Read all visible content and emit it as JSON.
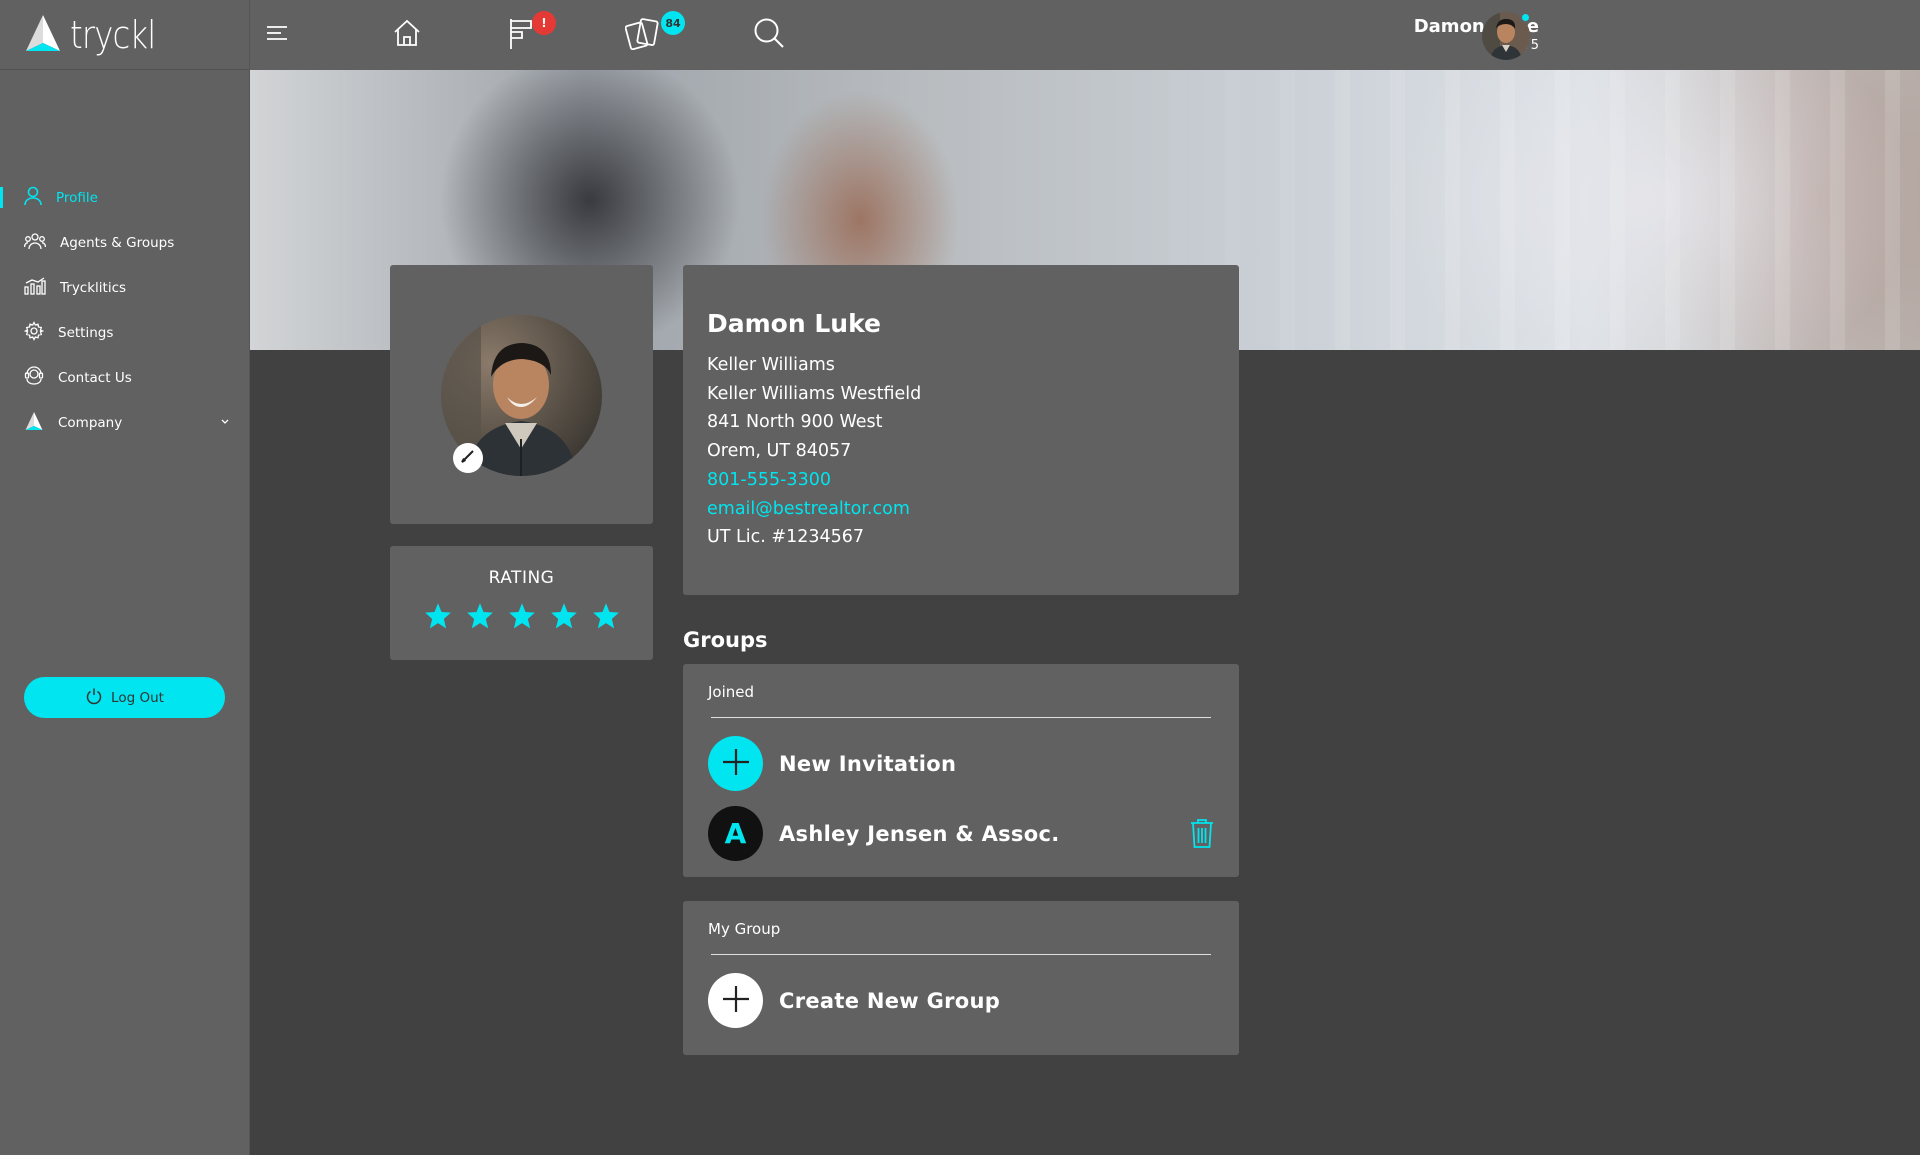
{
  "app": {
    "logo_text": "tryckl"
  },
  "sidebar": {
    "items": [
      {
        "label": "Profile",
        "icon": "user-icon",
        "active": true
      },
      {
        "label": "Agents & Groups",
        "icon": "group-icon"
      },
      {
        "label": "Trycklitics",
        "icon": "analytics-icon"
      },
      {
        "label": "Settings",
        "icon": "gear-icon"
      },
      {
        "label": "Contact Us",
        "icon": "contact-icon"
      },
      {
        "label": "Company",
        "icon": "company-logo-icon",
        "expandable": true
      }
    ],
    "logout_label": "Log Out"
  },
  "topbar": {
    "notifications_badge": "!",
    "cards_badge": "84",
    "user_name": "Damon Luke",
    "user_balance": "$ 19.75"
  },
  "profile": {
    "name": "Damon Luke",
    "brokerage": "Keller Williams",
    "office": "Keller Williams Westfield",
    "street": "841 North 900 West",
    "city_state_zip": "Orem, UT 84057",
    "phone": "801-555-3300",
    "email": "email@bestrealtor.com",
    "license": "UT Lic. #1234567"
  },
  "rating": {
    "title": "RATING",
    "stars": 5,
    "max": 5
  },
  "groups": {
    "heading": "Groups",
    "joined": {
      "label": "Joined",
      "new_invitation_label": "New Invitation",
      "items": [
        {
          "initial": "A",
          "name": "Ashley Jensen & Assoc."
        }
      ]
    },
    "my_group": {
      "label": "My Group",
      "create_label": "Create New Group"
    }
  },
  "colors": {
    "accent": "#00e5ef",
    "sidebar_bg": "#616161",
    "page_bg": "#414141",
    "badge_red": "#e53935"
  }
}
